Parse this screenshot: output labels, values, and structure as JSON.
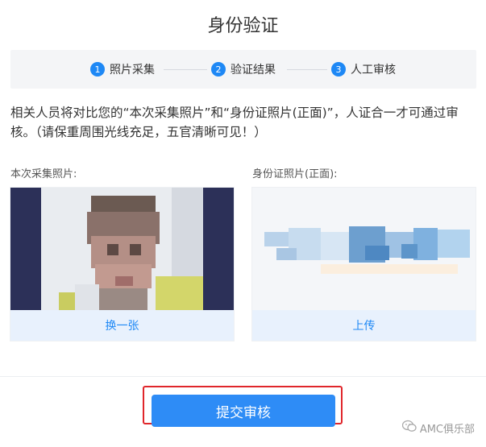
{
  "page": {
    "title": "身份验证"
  },
  "steps": [
    {
      "number": "1",
      "label": "照片采集"
    },
    {
      "number": "2",
      "label": "验证结果"
    },
    {
      "number": "3",
      "label": "人工审核"
    }
  ],
  "description": "相关人员将对比您的“本次采集照片”和“身份证照片(正面)”，人证合一才可通过审核。（请保重周围光线充足，五官清晰可见！）",
  "capture": {
    "label": "本次采集照片:",
    "button": "换一张"
  },
  "idcard": {
    "label": "身份证照片(正面):",
    "button": "上传"
  },
  "submit": {
    "label": "提交审核"
  },
  "watermark": {
    "text": "AMC俱乐部",
    "icon": "wechat-icon"
  },
  "colors": {
    "accent": "#2e8cf6",
    "highlight": "#e0262b"
  }
}
